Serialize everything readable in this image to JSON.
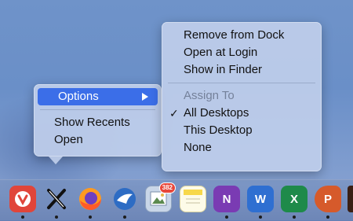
{
  "context_menu": {
    "items": [
      {
        "label": "Options",
        "highlighted": true,
        "has_submenu": true
      },
      {
        "label": "Show Recents"
      },
      {
        "label": "Open"
      }
    ]
  },
  "submenu": {
    "items": [
      {
        "label": "Remove from Dock"
      },
      {
        "label": "Open at Login"
      },
      {
        "label": "Show in Finder"
      },
      {
        "label": "Assign To",
        "disabled": true
      },
      {
        "label": "All Desktops",
        "checked": true
      },
      {
        "label": "This Desktop"
      },
      {
        "label": "None"
      }
    ],
    "check_mark": "✓"
  },
  "dock": {
    "apps": [
      {
        "name": "vivaldi-icon",
        "glyph": "V",
        "color": "#e0453a"
      },
      {
        "name": "x-app-icon",
        "glyph": "X",
        "color": "#f2f2f2"
      },
      {
        "name": "firefox-icon",
        "glyph": "",
        "color": "#ff8a1f"
      },
      {
        "name": "mail-bird-icon",
        "glyph": "",
        "color": "#3c7bd6"
      },
      {
        "name": "preview-icon",
        "glyph": "",
        "color": "#8aa3c4",
        "badge": "382"
      },
      {
        "name": "notes-icon",
        "glyph": "",
        "color": "#f7e27a"
      },
      {
        "name": "onenote-icon",
        "glyph": "N",
        "color": "#7a3bb3"
      },
      {
        "name": "word-icon",
        "glyph": "W",
        "color": "#2f6fd1"
      },
      {
        "name": "excel-icon",
        "glyph": "X",
        "color": "#1e8a4a"
      },
      {
        "name": "powerpoint-icon",
        "glyph": "P",
        "color": "#d65a2b"
      }
    ]
  }
}
